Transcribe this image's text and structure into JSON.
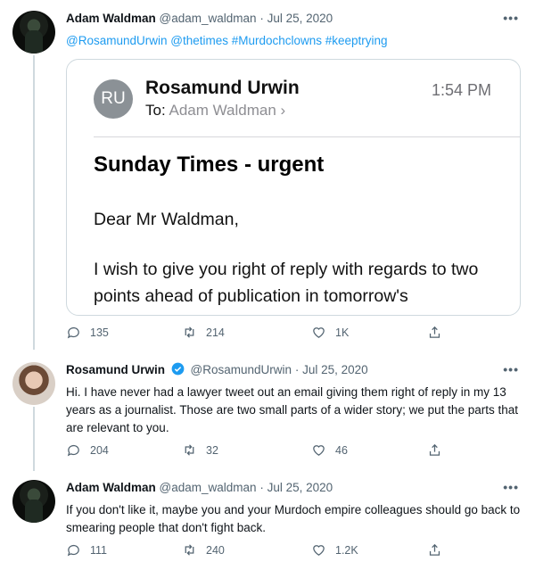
{
  "tweets": [
    {
      "name": "Adam Waldman",
      "handle": "@adam_waldman",
      "date": "Jul 25, 2020",
      "mentions": "@RosamundUrwin @thetimes #Murdochclowns #keeptrying",
      "replies": "135",
      "retweets": "214",
      "likes": "1K",
      "email": {
        "avatar_initials": "RU",
        "sender": "Rosamund Urwin",
        "to_label": "To:",
        "recipient": "Adam Waldman",
        "time": "1:54 PM",
        "subject": "Sunday Times - urgent",
        "greeting": "Dear Mr Waldman,",
        "paragraph": "I wish to give you right of reply with regards to two points ahead of publication in tomorrow's"
      }
    },
    {
      "name": "Rosamund Urwin",
      "handle": "@RosamundUrwin",
      "date": "Jul 25, 2020",
      "text": "Hi. I have never had a lawyer tweet out an email giving them right of reply in my 13 years as a journalist. Those are two small parts of a wider story; we put the parts that are relevant to you.",
      "replies": "204",
      "retweets": "32",
      "likes": "46"
    },
    {
      "name": "Adam Waldman",
      "handle": "@adam_waldman",
      "date": "Jul 25, 2020",
      "text": "If you don't like it, maybe you and your Murdoch empire colleagues should go back to smearing people that don't fight back.",
      "replies": "111",
      "retweets": "240",
      "likes": "1.2K"
    }
  ],
  "separator": "·",
  "more_glyph": "•••",
  "colors": {
    "link": "#1d9bf0",
    "muted": "#536471",
    "verified": "#1d9bf0"
  }
}
